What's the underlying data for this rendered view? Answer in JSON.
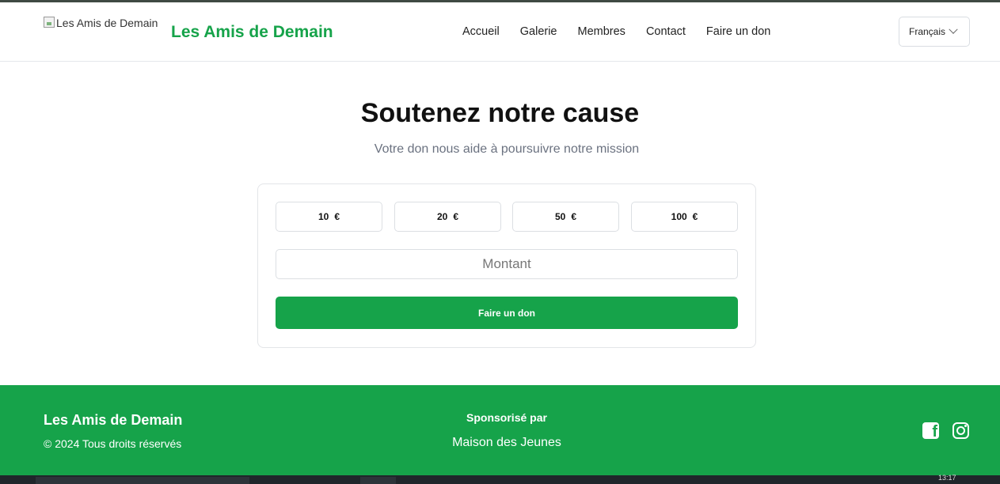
{
  "header": {
    "logo_alt": "Les Amis de Demain",
    "brand": "Les Amis de Demain",
    "nav": [
      "Accueil",
      "Galerie",
      "Membres",
      "Contact",
      "Faire un don"
    ],
    "language": "Français"
  },
  "main": {
    "title": "Soutenez notre cause",
    "subtitle": "Votre don nous aide à poursuivre notre mission",
    "amounts": [
      "10",
      "20",
      "50",
      "100"
    ],
    "currency": "€",
    "amount_placeholder": "Montant",
    "donate_label": "Faire un don"
  },
  "footer": {
    "brand": "Les Amis de Demain",
    "copyright": "© 2024 Tous droits réservés",
    "sponsored_label": "Sponsorisé par",
    "sponsor": "Maison des Jeunes",
    "social_icons": [
      "facebook-icon",
      "instagram-icon"
    ]
  },
  "taskbar": {
    "clock": "13:17"
  },
  "colors": {
    "brand_green": "#16a34a",
    "text_dark": "#111111",
    "muted": "#6b7280"
  }
}
